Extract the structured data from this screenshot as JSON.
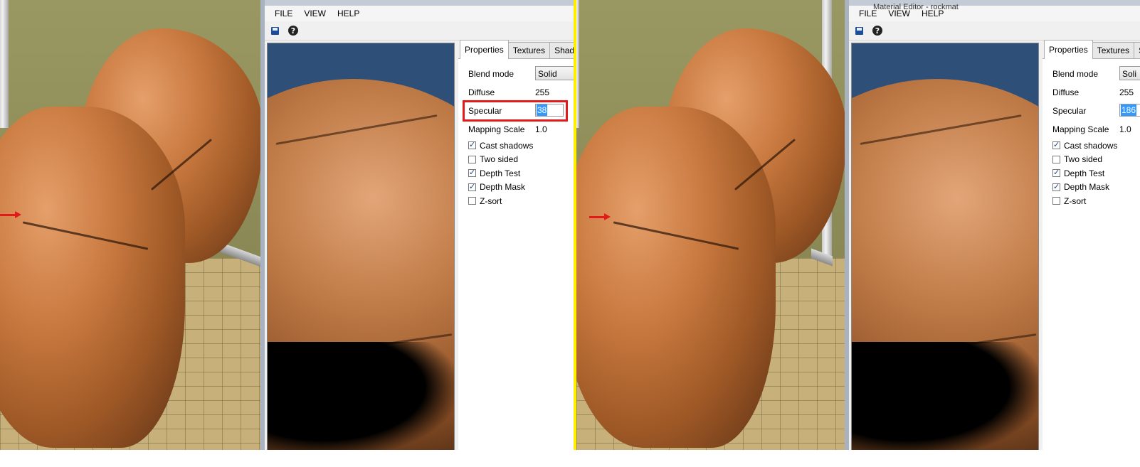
{
  "left_panel": {
    "window_title": "",
    "menu": [
      "FILE",
      "VIEW",
      "HELP"
    ],
    "toolbar_icons": [
      "save-icon",
      "help-icon"
    ],
    "tabs": [
      "Properties",
      "Textures",
      "Shade"
    ],
    "blend_mode_label": "Blend mode",
    "blend_mode_value": "Solid",
    "diffuse_label": "Diffuse",
    "diffuse_value": "255",
    "specular_label": "Specular",
    "specular_value": "38",
    "mapping_scale_label": "Mapping Scale",
    "mapping_scale_value": "1.0",
    "checkboxes": [
      {
        "label": "Cast shadows",
        "checked": true
      },
      {
        "label": "Two sided",
        "checked": false
      },
      {
        "label": "Depth Test",
        "checked": true
      },
      {
        "label": "Depth Mask",
        "checked": true
      },
      {
        "label": "Z-sort",
        "checked": false
      }
    ]
  },
  "right_panel": {
    "window_title": "Material Editor - rockmat",
    "menu": [
      "FILE",
      "VIEW",
      "HELP"
    ],
    "toolbar_icons": [
      "save-icon",
      "help-icon"
    ],
    "tabs": [
      "Properties",
      "Textures",
      "S"
    ],
    "blend_mode_label": "Blend mode",
    "blend_mode_value": "Soli",
    "diffuse_label": "Diffuse",
    "diffuse_value": "255",
    "specular_label": "Specular",
    "specular_value": "186",
    "mapping_scale_label": "Mapping Scale",
    "mapping_scale_value": "1.0",
    "checkboxes": [
      {
        "label": "Cast shadows",
        "checked": true
      },
      {
        "label": "Two sided",
        "checked": false
      },
      {
        "label": "Depth Test",
        "checked": true
      },
      {
        "label": "Depth Mask",
        "checked": true
      },
      {
        "label": "Z-sort",
        "checked": false
      }
    ]
  },
  "colors": {
    "highlight": "#e21b1b",
    "divider": "#ffee00",
    "preview_bg": "#2e4f78",
    "selection": "#3399ff"
  }
}
